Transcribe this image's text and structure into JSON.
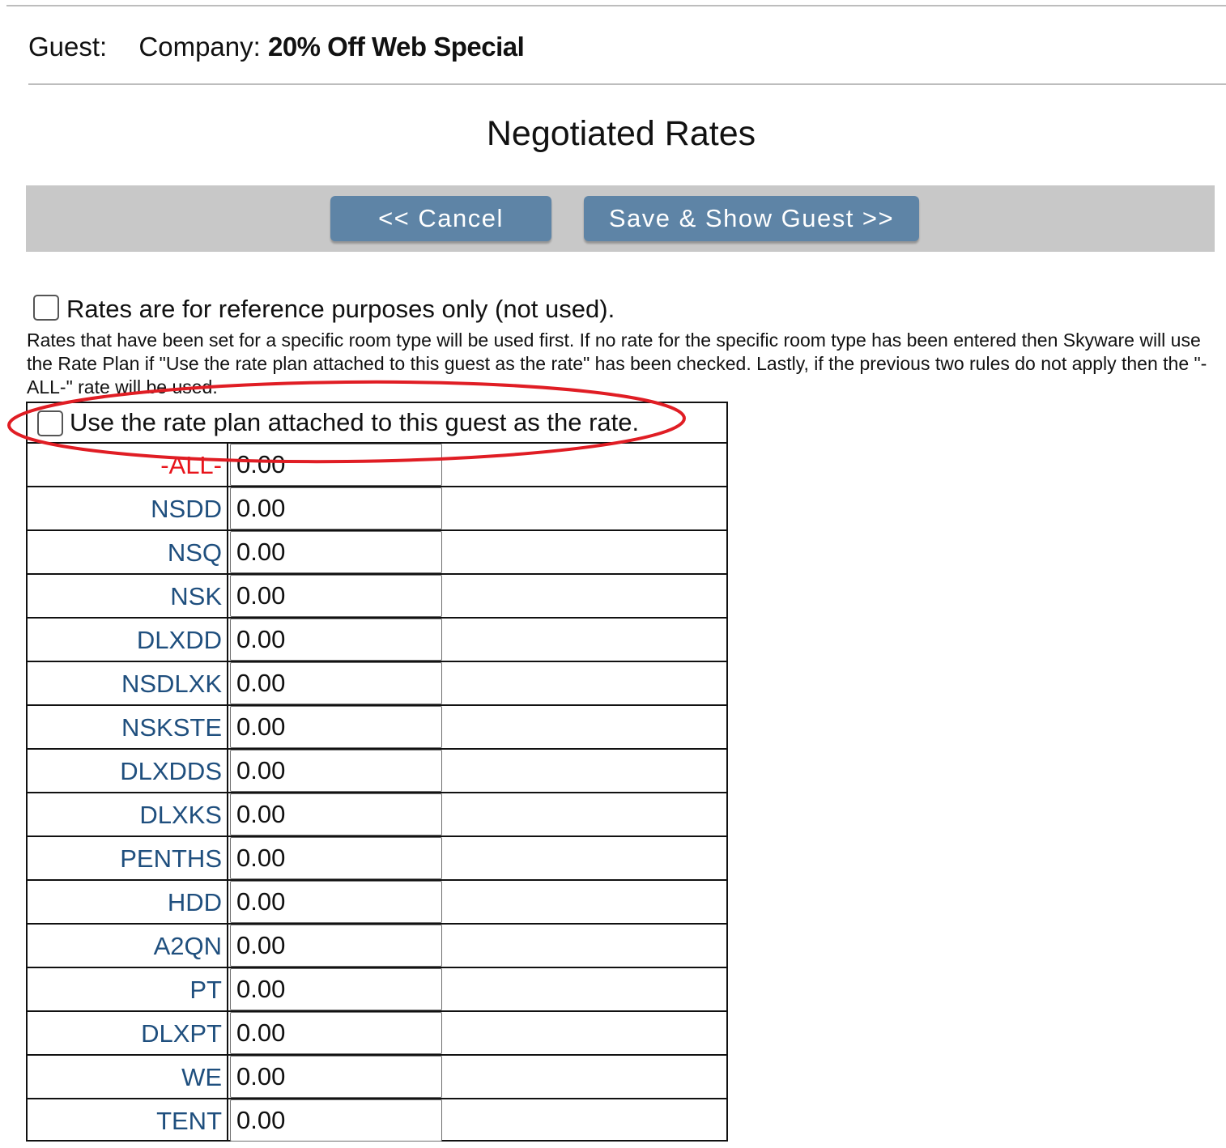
{
  "header": {
    "guest_label": "Guest:",
    "company_label": "Company:",
    "company_name": "20% Off Web Special"
  },
  "page_title": "Negotiated Rates",
  "toolbar": {
    "cancel_label": "<< Cancel",
    "save_label": "Save & Show Guest >>"
  },
  "options": {
    "reference_only_label": "Rates are for reference purposes only (not used).",
    "reference_only_checked": false,
    "use_rate_plan_label": "Use the rate plan attached to this guest as the rate.",
    "use_rate_plan_checked": false
  },
  "note": "Rates that have been set for a specific room type will be used first. If no rate for the specific room type has been entered then Skyware will use the Rate Plan if \"Use the rate plan attached to this guest as the rate\" has been checked. Lastly, if the previous two rules do not apply then the \"-ALL-\" rate will be used.",
  "rates": [
    {
      "code": "-ALL-",
      "value": "0.00"
    },
    {
      "code": "NSDD",
      "value": "0.00"
    },
    {
      "code": "NSQ",
      "value": "0.00"
    },
    {
      "code": "NSK",
      "value": "0.00"
    },
    {
      "code": "DLXDD",
      "value": "0.00"
    },
    {
      "code": "NSDLXK",
      "value": "0.00"
    },
    {
      "code": "NSKSTE",
      "value": "0.00"
    },
    {
      "code": "DLXDDS",
      "value": "0.00"
    },
    {
      "code": "DLXKS",
      "value": "0.00"
    },
    {
      "code": "PENTHS",
      "value": "0.00"
    },
    {
      "code": "HDD",
      "value": "0.00"
    },
    {
      "code": "A2QN",
      "value": "0.00"
    },
    {
      "code": "PT",
      "value": "0.00"
    },
    {
      "code": "DLXPT",
      "value": "0.00"
    },
    {
      "code": "WE",
      "value": "0.00"
    },
    {
      "code": "TENT",
      "value": "0.00"
    }
  ],
  "colors": {
    "button_bg": "#5e84a6",
    "toolbar_bg": "#c8c8c8",
    "code_text": "#1f4f7e",
    "all_code_text": "#e8141b",
    "annotation": "#e01d24"
  }
}
